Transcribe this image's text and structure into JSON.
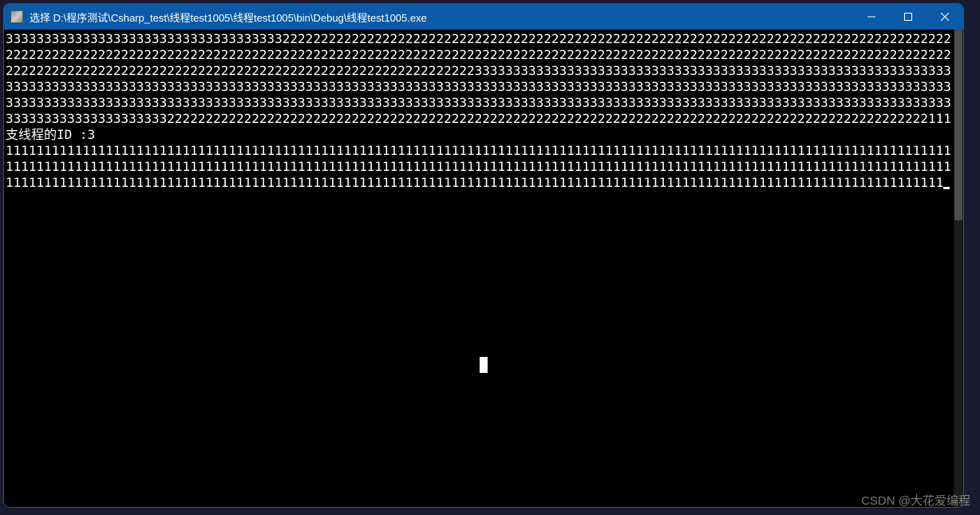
{
  "window": {
    "title": "选择 D:\\程序测试\\Csharp_test\\线程test1005\\线程test1005\\bin\\Debug\\线程test1005.exe"
  },
  "console": {
    "line1": "333333333333333333333333333333333333222222222222222222222222222222222222222222222222222222222222222222222222222222222222222222222222222222222222222",
    "line2": "222222222222222222222222222222222222222222222222222222222222222222222222222222222222222222222222222222222222222222222222222222222222222222222222222",
    "line3": "222222222222233333333333333333333333333333333333333333333333333333333333333333333333333333333333333333333333333333333333333333333333333333333333333",
    "line4": "333333333333333333333333333333333333333333333333333333333333333333333333333333333333333333333333333333333333333333333333333333333333333333333333333",
    "line5": "333333333333333333333333333333333333333333333333222222222222222222222222222222222222222222222222222222222222222222222222222222222222222222222222222",
    "line6": "111支线程的ID :3",
    "line7": "111111111111111111111111111111111111111111111111111111111111111111111111111111111111111111111111111111111111111111111111111111111111111111111111111",
    "line8": "111111111111111111111111111111111111111111111111111111111111111111111111111111111111111111111111111111111111111111111111111111111111111111111111111",
    "line9": "11111111111111111111111111111111111111111111111111111111111111111111111111"
  },
  "watermark": "CSDN @大花爱编程"
}
